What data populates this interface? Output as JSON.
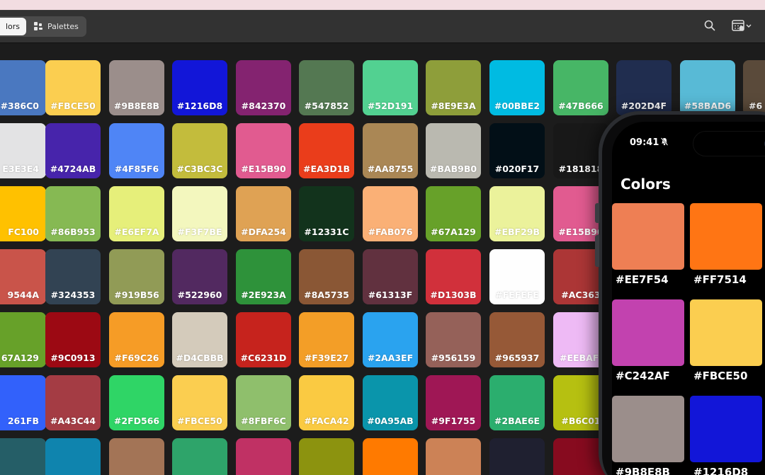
{
  "toolbar": {
    "tab_colors": "lors",
    "tab_palettes": "Palettes",
    "search_icon": "search-icon",
    "view_icon": "calendar-grid-icon"
  },
  "grid": {
    "rows": [
      [
        {
          "hex": "#386C0",
          "color": "#4a78c0"
        },
        {
          "hex": "#FBCE50",
          "color": "#FBCE50"
        },
        {
          "hex": "#9B8E8B",
          "color": "#9B8E8B"
        },
        {
          "hex": "#1216D8",
          "color": "#1216D8"
        },
        {
          "hex": "#842370",
          "color": "#842370"
        },
        {
          "hex": "#547852",
          "color": "#547852"
        },
        {
          "hex": "#52D191",
          "color": "#52D191"
        },
        {
          "hex": "#8E9E3A",
          "color": "#8E9E3A"
        },
        {
          "hex": "#00BBE2",
          "color": "#00BBE2"
        },
        {
          "hex": "#47B666",
          "color": "#47B666"
        },
        {
          "hex": "#202D4F",
          "color": "#202D4F"
        },
        {
          "hex": "#58BAD6",
          "color": "#58BAD6"
        },
        {
          "hex": "#6",
          "color": "#5a4a3a"
        }
      ],
      [
        {
          "hex": "E3E3E4",
          "color": "#E3E3E4"
        },
        {
          "hex": "#4724AB",
          "color": "#4724AB"
        },
        {
          "hex": "#4F85F6",
          "color": "#4F85F6"
        },
        {
          "hex": "#C3BC3C",
          "color": "#C3BC3C"
        },
        {
          "hex": "#E15B90",
          "color": "#E15B90"
        },
        {
          "hex": "#EA3D1B",
          "color": "#EA3D1B"
        },
        {
          "hex": "#AA8755",
          "color": "#AA8755"
        },
        {
          "hex": "#BAB9B0",
          "color": "#BAB9B0"
        },
        {
          "hex": "#020F17",
          "color": "#020F17"
        },
        {
          "hex": "#181818",
          "color": "#181818"
        },
        {
          "hex": "",
          "color": "#f2f2f2"
        },
        {
          "hex": "",
          "color": "#1c1c1c"
        },
        {
          "hex": "",
          "color": "#1c1c1c"
        }
      ],
      [
        {
          "hex": "FC100",
          "color": "#FFC100"
        },
        {
          "hex": "#86B953",
          "color": "#86B953"
        },
        {
          "hex": "#E6EF7A",
          "color": "#E6EF7A"
        },
        {
          "hex": "#F3F7BE",
          "color": "#F3F7BE"
        },
        {
          "hex": "#DFA254",
          "color": "#DFA254"
        },
        {
          "hex": "#12331C",
          "color": "#12331C"
        },
        {
          "hex": "#FAB076",
          "color": "#FAB076"
        },
        {
          "hex": "#67A129",
          "color": "#67A129"
        },
        {
          "hex": "#EBF29B",
          "color": "#EBF29B"
        },
        {
          "hex": "#E15B90",
          "color": "#E15B90"
        },
        {
          "hex": "",
          "color": "#1c1c1c"
        },
        {
          "hex": "",
          "color": "#1c1c1c"
        },
        {
          "hex": "",
          "color": "#1c1c1c"
        }
      ],
      [
        {
          "hex": "9544A",
          "color": "#C9544A"
        },
        {
          "hex": "#324353",
          "color": "#324353"
        },
        {
          "hex": "#919B56",
          "color": "#919B56"
        },
        {
          "hex": "#522960",
          "color": "#522960"
        },
        {
          "hex": "#2E923A",
          "color": "#2E923A"
        },
        {
          "hex": "#8A5735",
          "color": "#8A5735"
        },
        {
          "hex": "#61313F",
          "color": "#61313F"
        },
        {
          "hex": "#D1303B",
          "color": "#D1303B"
        },
        {
          "hex": "#FEFEFE",
          "color": "#FEFEFE"
        },
        {
          "hex": "#AC363",
          "color": "#AC3636"
        },
        {
          "hex": "",
          "color": "#1c1c1c"
        },
        {
          "hex": "",
          "color": "#1c1c1c"
        },
        {
          "hex": "",
          "color": "#1c1c1c"
        }
      ],
      [
        {
          "hex": "67A129",
          "color": "#67A129"
        },
        {
          "hex": "#9C0913",
          "color": "#9C0913"
        },
        {
          "hex": "#F69C26",
          "color": "#F69C26"
        },
        {
          "hex": "#D4CBBB",
          "color": "#D4CBBB"
        },
        {
          "hex": "#C6231D",
          "color": "#C6231D"
        },
        {
          "hex": "#F39E27",
          "color": "#F39E27"
        },
        {
          "hex": "#2AA3EF",
          "color": "#2AA3EF"
        },
        {
          "hex": "#956159",
          "color": "#956159"
        },
        {
          "hex": "#965937",
          "color": "#965937"
        },
        {
          "hex": "#EEBAFI",
          "color": "#EEBAF5"
        },
        {
          "hex": "",
          "color": "#1c1c1c"
        },
        {
          "hex": "",
          "color": "#1c1c1c"
        },
        {
          "hex": "",
          "color": "#1c1c1c"
        }
      ],
      [
        {
          "hex": "261FB",
          "color": "#3261FB"
        },
        {
          "hex": "#A43C44",
          "color": "#A43C44"
        },
        {
          "hex": "#2FD566",
          "color": "#2FD566"
        },
        {
          "hex": "#FBCE50",
          "color": "#FBCE50"
        },
        {
          "hex": "#8FBF6C",
          "color": "#8FBF6C"
        },
        {
          "hex": "#FACA42",
          "color": "#FACA42"
        },
        {
          "hex": "#0A95AB",
          "color": "#0A95AB"
        },
        {
          "hex": "#9F1755",
          "color": "#9F1755"
        },
        {
          "hex": "#2BAE6E",
          "color": "#2BAE6E"
        },
        {
          "hex": "#B6C01",
          "color": "#B6C011"
        },
        {
          "hex": "",
          "color": "#1c1c1c"
        },
        {
          "hex": "",
          "color": "#1c1c1c"
        },
        {
          "hex": "",
          "color": "#1c1c1c"
        }
      ],
      [
        {
          "hex": "5E67",
          "color": "#255E67"
        },
        {
          "hex": "#0F84AE",
          "color": "#0F84AE"
        },
        {
          "hex": "#A37456",
          "color": "#A37456"
        },
        {
          "hex": "#2EA46A",
          "color": "#2EA46A"
        },
        {
          "hex": "#C03164",
          "color": "#C03164"
        },
        {
          "hex": "#8C930F",
          "color": "#8C930F"
        },
        {
          "hex": "#FF7A00",
          "color": "#FF7A00"
        },
        {
          "hex": "#CC8256",
          "color": "#CC8256"
        },
        {
          "hex": "#1F2030",
          "color": "#1F2030"
        },
        {
          "hex": "#870B1F",
          "color": "#870B1F"
        },
        {
          "hex": "",
          "color": "#1c1c1c"
        },
        {
          "hex": "",
          "color": "#1c1c1c"
        },
        {
          "hex": "",
          "color": "#1c1c1c"
        }
      ]
    ]
  },
  "phone": {
    "time": "09:41",
    "title": "Colors",
    "swatches": [
      {
        "hex": "#EE7F54",
        "color": "#EE7F54"
      },
      {
        "hex": "#FF7514",
        "color": "#FF7514"
      },
      {
        "hex": "#C242AF",
        "color": "#C242AF"
      },
      {
        "hex": "#FBCE50",
        "color": "#FBCE50"
      },
      {
        "hex": "#9B8E8B",
        "color": "#9B8E8B"
      },
      {
        "hex": "#1216D8",
        "color": "#1216D8"
      }
    ]
  }
}
